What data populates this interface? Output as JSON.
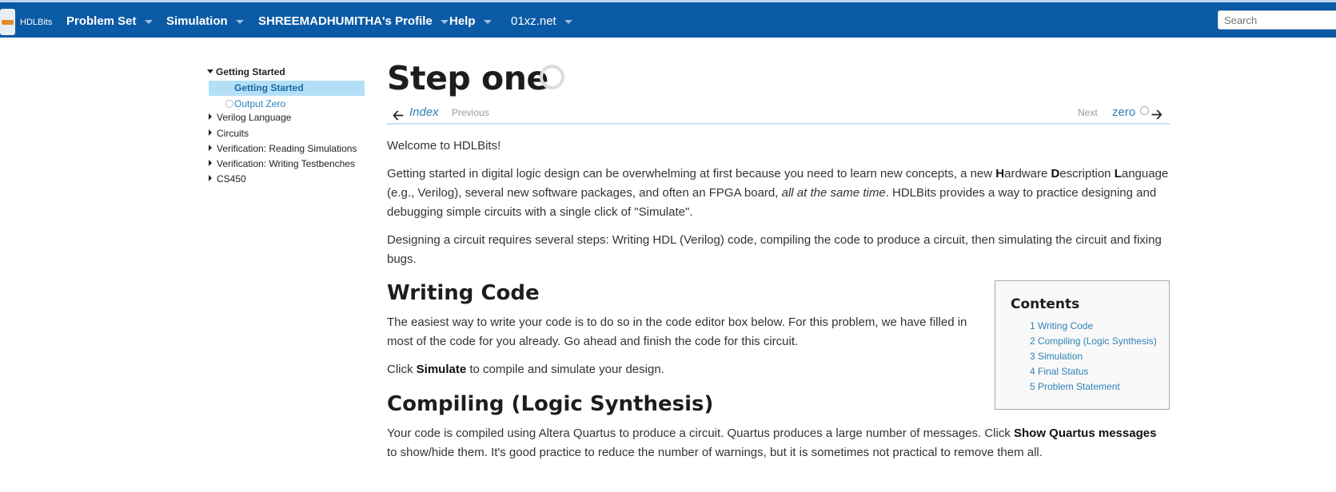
{
  "nav": {
    "site_name": "HDLBits",
    "items": [
      {
        "label": "Problem Set"
      },
      {
        "label": "Simulation"
      },
      {
        "label": "SHREEMADHUMITHA's Profile"
      },
      {
        "label": "Help"
      },
      {
        "label": "01xz.net"
      }
    ],
    "search_placeholder": "Search"
  },
  "sidebar": {
    "expanded_section": "Getting Started",
    "active_item": "Getting Started",
    "child_item": "Output Zero",
    "sections": [
      {
        "label": "Verilog Language"
      },
      {
        "label": "Circuits"
      },
      {
        "label": "Verification: Reading Simulations"
      },
      {
        "label": "Verification: Writing Testbenches"
      },
      {
        "label": "CS450"
      }
    ]
  },
  "page": {
    "title": "Step one",
    "nav": {
      "index_label": "Index",
      "previous_label": "Previous",
      "next_label": "Next",
      "next_link": "zero"
    },
    "welcome": "Welcome to HDLBits!",
    "intro": {
      "part1": "Getting started in digital logic design can be overwhelming at first because you need to learn new concepts, a new ",
      "h": "H",
      "h_rest": "ardware ",
      "d": "D",
      "d_rest": "escription ",
      "l": "L",
      "l_rest": "anguage (e.g., Verilog), several new software packages, and often an FPGA board, ",
      "emph": "all at the same time",
      "part2": ". HDLBits provides a way to practice designing and debugging simple circuits with a single click of \"Simulate\"."
    },
    "steps_paragraph": "Designing a circuit requires several steps: Writing HDL (Verilog) code, compiling the code to produce a circuit, then simulating the circuit and fixing bugs.",
    "writing_code": {
      "heading": "Writing Code",
      "p1": "The easiest way to write your code is to do so in the code editor box below. For this problem, we have filled in most of the code for you already. Go ahead and finish the code for this circuit.",
      "p2_before": "Click ",
      "p2_bold": "Simulate",
      "p2_after": " to compile and simulate your design."
    },
    "compiling": {
      "heading": "Compiling (Logic Synthesis)",
      "p_before": "Your code is compiled using Altera Quartus to produce a circuit. Quartus produces a large number of messages. Click ",
      "p_bold": "Show Quartus messages",
      "p_after": " to show/hide them. It's good practice to reduce the number of warnings, but it is sometimes not practical to remove them all."
    }
  },
  "contents": {
    "title": "Contents",
    "items": [
      {
        "label": "1 Writing Code"
      },
      {
        "label": "2 Compiling (Logic Synthesis)"
      },
      {
        "label": "3 Simulation"
      },
      {
        "label": "4 Final Status"
      },
      {
        "label": "5 Problem Statement"
      }
    ]
  }
}
